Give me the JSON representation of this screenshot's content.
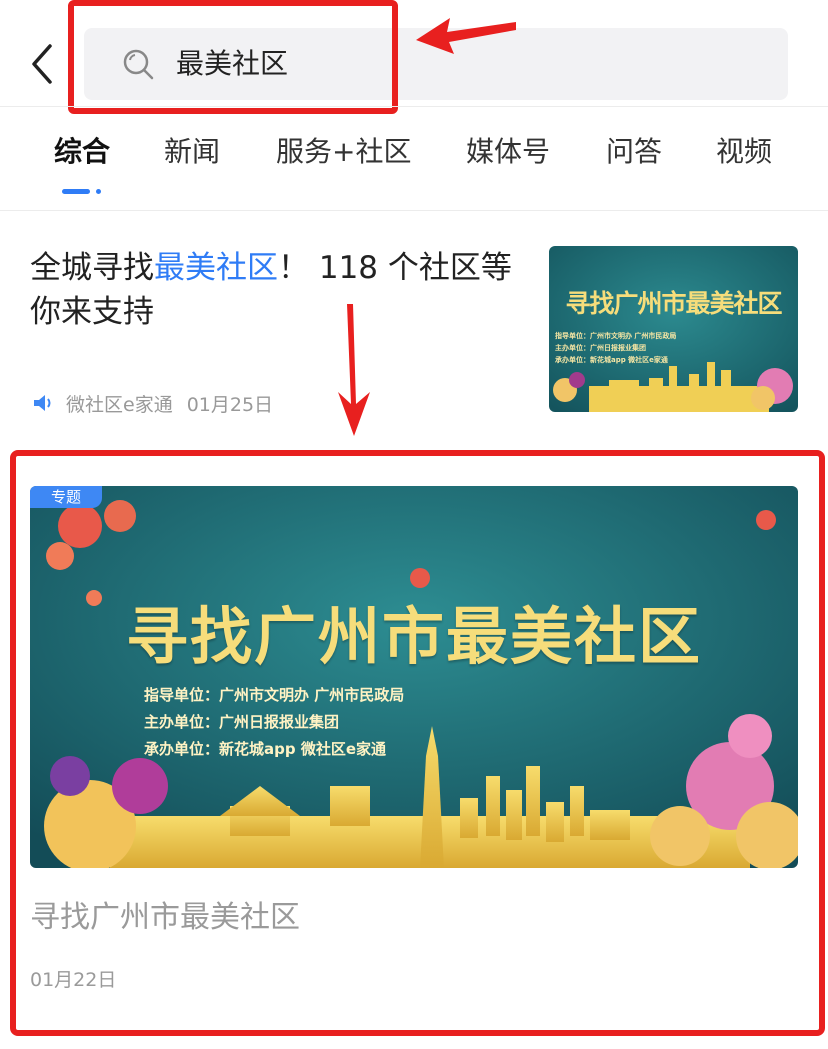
{
  "header": {
    "back_icon": "chevron-left-icon",
    "search_icon": "search-icon",
    "search_query": "最美社区"
  },
  "tabs": [
    {
      "label": "综合",
      "active": true
    },
    {
      "label": "新闻",
      "active": false
    },
    {
      "label": "服务+社区",
      "active": false
    },
    {
      "label": "媒体号",
      "active": false
    },
    {
      "label": "问答",
      "active": false
    },
    {
      "label": "视频",
      "active": false
    }
  ],
  "article1": {
    "title_before": "全城寻找",
    "title_highlight": "最美社区",
    "title_after": "！ 118 个社区等你来支持",
    "source_icon": "speaker-icon",
    "source": "微社区e家通",
    "date": "01月25日",
    "thumbnail": {
      "headline": "寻找广州市最美社区",
      "lines": [
        "指导单位：广州市文明办 广州市民政局",
        "主办单位：广州日报报业集团",
        "承办单位：新花城app 微社区e家通"
      ]
    }
  },
  "card": {
    "badge": "专题",
    "banner": {
      "headline": "寻找广州市最美社区",
      "line1": "指导单位：广州市文明办  广州市民政局",
      "line2": "主办单位：广州日报报业集团",
      "line3": "承办单位：新花城app 微社区e家通"
    },
    "title": "寻找广州市最美社区",
    "date": "01月22日"
  },
  "colors": {
    "accent": "#2f7cf6",
    "annotation_red": "#e8201f",
    "banner_teal": "#1e6b74",
    "gold": "#f2d56a"
  }
}
